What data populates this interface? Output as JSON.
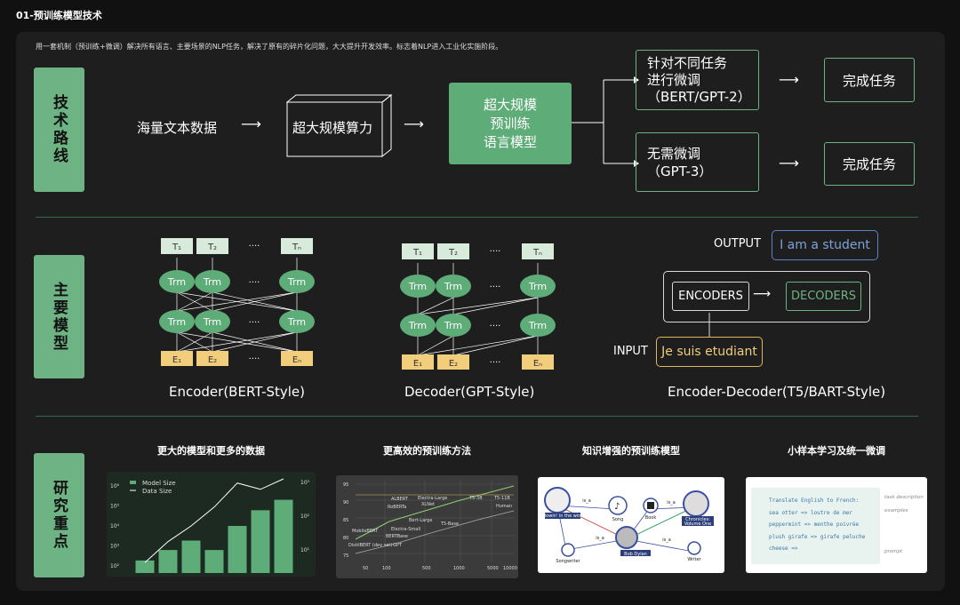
{
  "title": "01-预训练模型技术",
  "intro": "用一套机制（预训练+微调）解决所有语言、主要场景的NLP任务，解决了原有的碎片化问题，大大提升开发效率。标志着NLP进入工业化实施阶段。",
  "colors": {
    "accent": "#6db383",
    "background": "#111111",
    "panel": "#1e1e1e"
  },
  "sections": {
    "tech_route": "技术路线",
    "main_models": "主要模型",
    "research_focus": "研究重点"
  },
  "route": {
    "data": "海量文本数据",
    "compute": "超大规模算力",
    "model_l1": "超大规模",
    "model_l2": "预训练",
    "model_l3": "语言模型",
    "ft_l1": "针对不同任务",
    "ft_l2": "进行微调",
    "ft_l3": "（BERT/GPT-2）",
    "noft_l1": "无需微调",
    "noft_l2": "（GPT-3）",
    "done1": "完成任务",
    "done2": "完成任务"
  },
  "models": {
    "encoder_caption": "Encoder(BERT-Style)",
    "decoder_caption": "Decoder(GPT-Style)",
    "encdec_caption": "Encoder-Decoder(T5/BART-Style)",
    "dots": "····",
    "output_label": "OUTPUT",
    "output_text": "I am a student",
    "encoders": "ENCODERS",
    "decoders": "DECODERS",
    "input_label": "INPUT",
    "input_text": "Je  suis  etudiant"
  },
  "research": {
    "t1": "更大的模型和更多的数据",
    "t2": "更高效的预训练方法",
    "t3": "知识增强的预训练模型",
    "t4": "小样本学习及统一微调",
    "legend_model": "Model Size",
    "legend_data": "Data Size",
    "prompt_lines": [
      "Translate English to French:",
      "sea otter => loutre de mer",
      "peppermint => menthe poivrée",
      "plush girafe => girafe peluche",
      "cheese =>"
    ],
    "prompt_notes": [
      "task description",
      "examples",
      "prompt"
    ]
  },
  "chart_data": {
    "type": "bar",
    "values": [
      1.2,
      2.2,
      3.1,
      2.2,
      4.5,
      6.0,
      7.0
    ],
    "line": [
      1.0,
      3.0,
      4.5,
      6.3,
      8.6,
      8.0,
      9.0
    ],
    "y_ticks": [
      "10⁶",
      "10⁵",
      "10⁴",
      "10³",
      "10²"
    ],
    "y2_ticks": [
      "10³",
      "10²",
      "10¹"
    ]
  }
}
